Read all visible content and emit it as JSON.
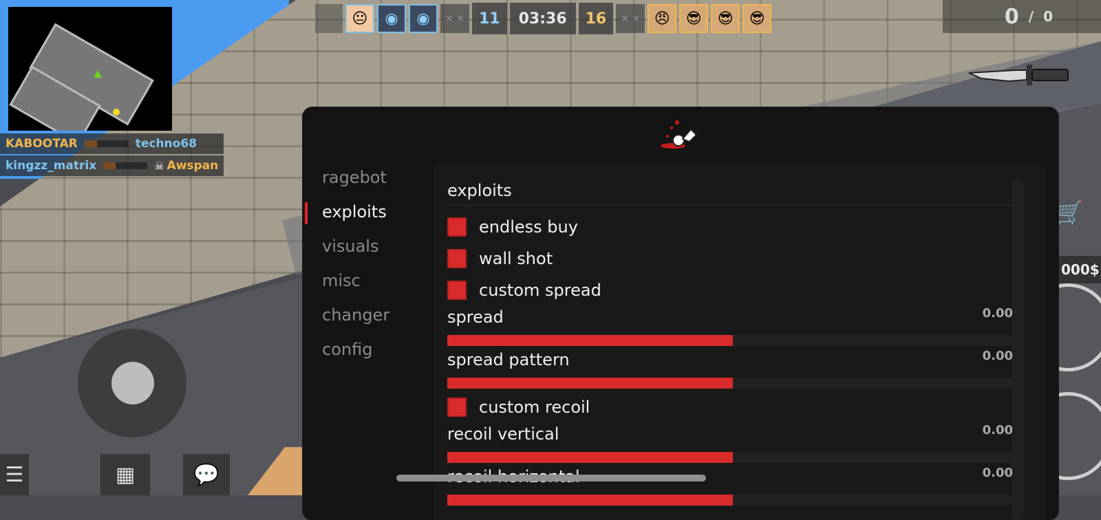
{
  "killfeed": [
    {
      "killer": "KABOOTAR",
      "weapon": "rifle-icon",
      "victim": "techno68",
      "headshot": false
    },
    {
      "killer": "kingzz_matrix",
      "weapon": "rifle-icon",
      "victim": "Awspan",
      "headshot": true
    }
  ],
  "scoreboard": {
    "ct_score": "11",
    "timer": "03:36",
    "t_score": "16",
    "dead_marker": "× ×",
    "ct_players": [
      "player-face-icon",
      "gasmask-face-icon",
      "gasmask-face-icon"
    ],
    "t_players": [
      "bandana-face-icon",
      "sunglasses-face-icon",
      "sunglasses-face-icon",
      "sunglasses-face-icon"
    ]
  },
  "ammo": {
    "clip": "0",
    "separator": "/",
    "reserve": "0"
  },
  "money": "000$",
  "menu": {
    "logo": "blood-splatter-logo",
    "nav": [
      {
        "label": "ragebot",
        "active": false
      },
      {
        "label": "exploits",
        "active": true
      },
      {
        "label": "visuals",
        "active": false
      },
      {
        "label": "misc",
        "active": false
      },
      {
        "label": "changer",
        "active": false
      },
      {
        "label": "config",
        "active": false
      }
    ],
    "section_title": "exploits",
    "checkboxes": {
      "endless_buy": "endless buy",
      "wall_shot": "wall shot",
      "custom_spread": "custom spread",
      "custom_recoil": "custom recoil"
    },
    "sliders": {
      "spread": {
        "label": "spread",
        "value": "0.00",
        "fill": 0.5
      },
      "spread_pattern": {
        "label": "spread pattern",
        "value": "0.00",
        "fill": 0.5
      },
      "recoil_vertical": {
        "label": "recoil vertical",
        "value": "0.00",
        "fill": 0.5
      },
      "recoil_horizontal": {
        "label": "recoil horizontal",
        "value": "0.00",
        "fill": 0.5
      }
    }
  },
  "colors": {
    "accent": "#d92b2b",
    "menu_bg": "#141414",
    "panel_bg": "#191919",
    "ct": "#8fd0ff",
    "t": "#f2c46a"
  }
}
